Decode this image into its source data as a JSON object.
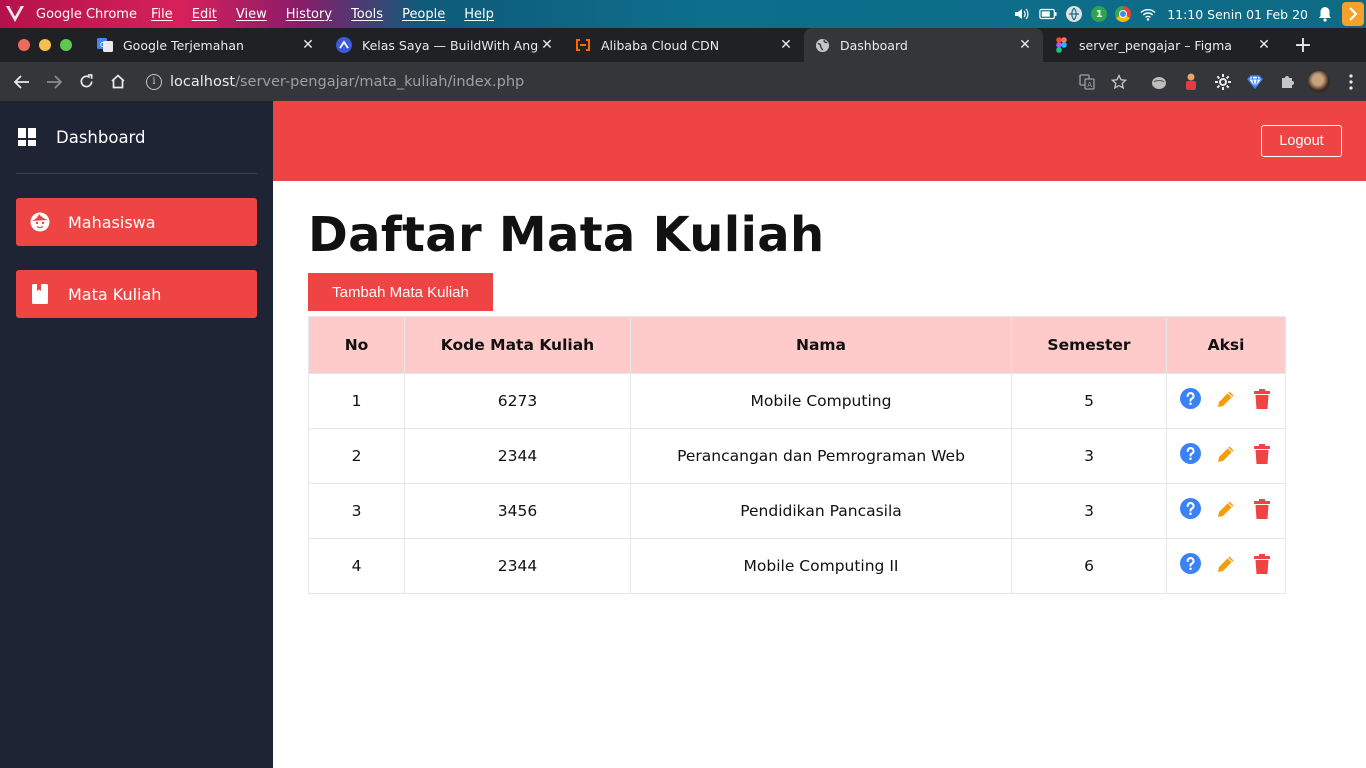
{
  "os": {
    "app_name": "Google Chrome",
    "menu": [
      "File",
      "Edit",
      "View",
      "History",
      "Tools",
      "People",
      "Help"
    ],
    "tray_badge": "1",
    "clock": "11:10 Senin 01 Feb 20",
    "icons": [
      "volume-icon",
      "battery-icon",
      "network-icon",
      "chrome-icon",
      "wifi-icon",
      "bell-icon",
      "next-arrow-icon"
    ]
  },
  "browser": {
    "tabs": [
      {
        "title": "Google Terjemahan",
        "favicon": "google-translate-icon",
        "active": false
      },
      {
        "title": "Kelas Saya — BuildWith Angga",
        "favicon": "buildwith-angga-icon",
        "active": false
      },
      {
        "title": "Alibaba Cloud CDN",
        "favicon": "alibaba-cloud-icon",
        "active": false
      },
      {
        "title": "Dashboard",
        "favicon": "globe-icon",
        "active": true
      },
      {
        "title": "server_pengajar – Figma",
        "favicon": "figma-icon",
        "active": false
      }
    ],
    "url_host": "localhost",
    "url_path": "/server-pengajar/mata_kuliah/index.php"
  },
  "sidebar": {
    "brand": "Dashboard",
    "items": [
      {
        "label": "Mahasiswa",
        "icon": "face-icon"
      },
      {
        "label": "Mata Kuliah",
        "icon": "book-icon"
      }
    ]
  },
  "header": {
    "logout_label": "Logout"
  },
  "main": {
    "title": "Daftar Mata Kuliah",
    "add_button": "Tambah Mata Kuliah",
    "table": {
      "headers": [
        "No",
        "Kode Mata Kuliah",
        "Nama",
        "Semester",
        "Aksi"
      ],
      "rows": [
        {
          "no": "1",
          "kode": "6273",
          "nama": "Mobile Computing",
          "semester": "5"
        },
        {
          "no": "2",
          "kode": "2344",
          "nama": "Perancangan dan Pemrograman Web",
          "semester": "3"
        },
        {
          "no": "3",
          "kode": "3456",
          "nama": "Pendidikan Pancasila",
          "semester": "3"
        },
        {
          "no": "4",
          "kode": "2344",
          "nama": "Mobile Computing II",
          "semester": "6"
        }
      ],
      "action_icons": [
        "help-icon",
        "edit-icon",
        "delete-icon"
      ]
    }
  },
  "colors": {
    "accent_red": "#ef4444",
    "header_pink": "#fecaca",
    "sidebar_bg": "#1e2433",
    "help_blue": "#3b82f6",
    "edit_amber": "#f59e0b",
    "delete_red": "#ef4444"
  }
}
